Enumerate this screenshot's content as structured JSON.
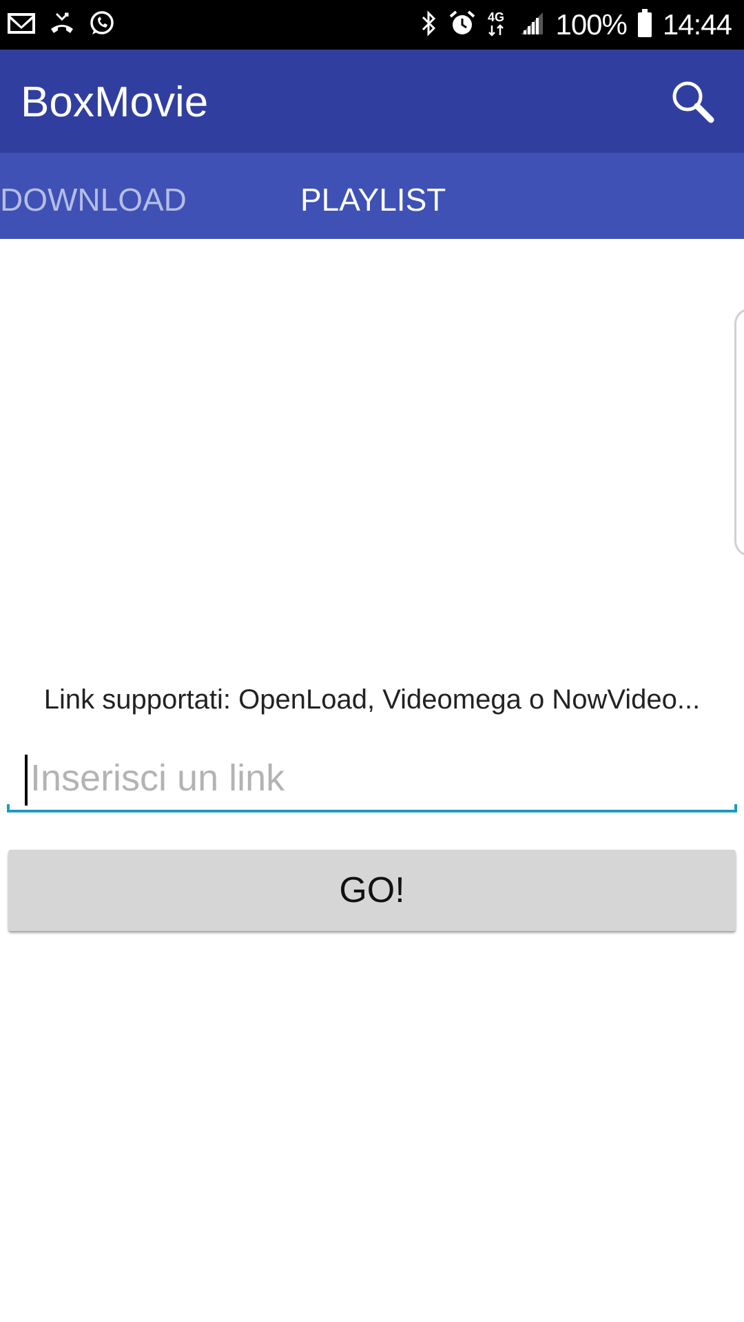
{
  "status_bar": {
    "notifications": [
      "gmail-icon",
      "missed-call-icon",
      "whatsapp-icon"
    ],
    "indicators": [
      "bluetooth-icon",
      "alarm-icon",
      "4g-icon",
      "signal-icon"
    ],
    "network_label": "4G",
    "battery": "100%",
    "time": "14:44"
  },
  "app_bar": {
    "title": "BoxMovie",
    "search_icon": "search-icon"
  },
  "tabs": [
    {
      "label": "DOWNLOAD",
      "selected": false
    },
    {
      "label": "PLAYLIST",
      "selected": true
    }
  ],
  "main": {
    "info_text": "Link supportati: OpenLoad, Videomega o NowVideo...",
    "link_input": {
      "value": "",
      "placeholder": "Inserisci un link"
    },
    "go_button_label": "GO!"
  },
  "colors": {
    "app_bar": "#303f9f",
    "tab_bar": "#3f51b5",
    "input_underline": "#1e9ac4",
    "button": "#d6d6d6"
  }
}
